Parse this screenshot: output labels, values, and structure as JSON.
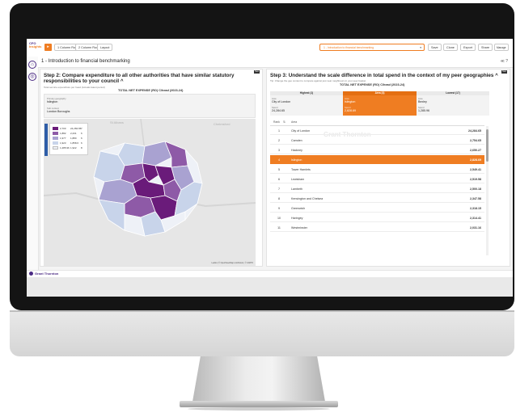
{
  "app": {
    "logo_top": "CFO",
    "logo_bottom": "Insights",
    "toolbar_buttons": [
      "1 Column Row",
      "2 Column Row",
      "Layout"
    ],
    "dropdown_value": "1 - Introduction to financial benchmarking",
    "right_buttons": [
      "Save",
      "Clone",
      "Export",
      "Share",
      "Manage"
    ],
    "page_title": "1 - Introduction to financial benchmarking",
    "title_tools": "≪ ?",
    "footer_brand": "Grant Thornton",
    "accent_color": "#ef7d22",
    "brand_color": "#4b2a84"
  },
  "left_panel": {
    "step_title": "Step 2: Compare expenditure to all other authorities that have similar statutory responsibilities to your council ^",
    "subtitle": "Total service expenditure per head (Actuals latest period)",
    "tag": "New",
    "chart_title": "TOTAL NET EXPENSE (RO) C/head (2023-24)",
    "filter1_label": "Primary geography",
    "filter1_value": "Islington",
    "filter2_label": "Sub context",
    "filter2_value": "London Boroughs",
    "map_places": [
      "St Albans",
      "Chelmsford"
    ],
    "map_credit": "Leaflet | © OpenStreetMap contributors, © CARTO",
    "legend": [
      {
        "lo": "2,700",
        "hi": "24,284.65",
        "count": "7",
        "color": "#6a1b7a"
      },
      {
        "lo": "1,882",
        "hi": "2,231",
        "count": "6",
        "color": "#8e5aa7"
      },
      {
        "lo": "1,977",
        "hi": "1,880",
        "count": "6",
        "color": "#a9a2d1"
      },
      {
        "lo": "1,923",
        "hi": "1,858.6",
        "count": "6",
        "color": "#c8d4ea"
      },
      {
        "lo": "1,285.96",
        "hi": "1,922",
        "count": "8",
        "color": "#eef1f7"
      }
    ]
  },
  "right_panel": {
    "step_title": "Step 3: Understand the scale difference in total spend in the context of my peer geographies ^",
    "subtitle": "Tip: Change the geo context to compare against just near neighbours in your peer basket",
    "tag": "New",
    "chart_title": "TOTAL NET EXPENSE (RO) C/head (2023-24)",
    "compare": [
      {
        "header": "Highest (1)",
        "area_label": "Area",
        "area": "City of London",
        "spend_label": "Spend",
        "spend": "24,284.65"
      },
      {
        "header": "Area (4)",
        "area_label": "Area",
        "area": "Islington",
        "spend_label": "Spend",
        "spend": "2,828.69"
      },
      {
        "header": "Lowest (17)",
        "area_label": "Area",
        "area": "Bexley",
        "spend_label": "Spend",
        "spend": "1,285.96"
      }
    ],
    "list_headers": {
      "rank": "Rank",
      "area": "Area"
    },
    "watermark": "Grant Thornton",
    "rows": [
      {
        "rank": "1",
        "area": "City of London",
        "spend": "24,284.65"
      },
      {
        "rank": "2",
        "area": "Camden",
        "spend": "2,754.65"
      },
      {
        "rank": "3",
        "area": "Hackney",
        "spend": "2,650.27"
      },
      {
        "rank": "4",
        "area": "Islington",
        "spend": "2,828.69"
      },
      {
        "rank": "5",
        "area": "Tower Hamlets",
        "spend": "2,549.41"
      },
      {
        "rank": "6",
        "area": "Lewisham",
        "spend": "2,519.58"
      },
      {
        "rank": "7",
        "area": "Lambeth",
        "spend": "2,500.18"
      },
      {
        "rank": "8",
        "area": "Kensington and Chelsea",
        "spend": "2,347.58"
      },
      {
        "rank": "9",
        "area": "Greenwich",
        "spend": "2,318.15"
      },
      {
        "rank": "10",
        "area": "Haringey",
        "spend": "2,314.41"
      },
      {
        "rank": "11",
        "area": "Westminster",
        "spend": "2,031.16"
      }
    ],
    "highlight_rank": "4"
  }
}
